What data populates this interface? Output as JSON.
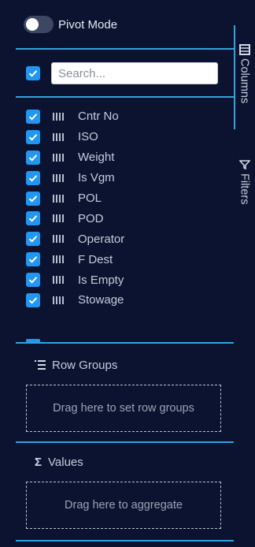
{
  "pivot": {
    "label": "Pivot Mode",
    "enabled": false
  },
  "search": {
    "placeholder": "Search...",
    "value": ""
  },
  "columns": [
    {
      "label": "Cntr No",
      "checked": true
    },
    {
      "label": "ISO",
      "checked": true
    },
    {
      "label": "Weight",
      "checked": true
    },
    {
      "label": "Is Vgm",
      "checked": true
    },
    {
      "label": "POL",
      "checked": true
    },
    {
      "label": "POD",
      "checked": true
    },
    {
      "label": "Operator",
      "checked": true
    },
    {
      "label": "F Dest",
      "checked": true
    },
    {
      "label": "Is Empty",
      "checked": true
    },
    {
      "label": "Stowage",
      "checked": true
    }
  ],
  "row_groups": {
    "title": "Row Groups",
    "drop_text": "Drag here to set row groups",
    "icon": "row-groups-icon"
  },
  "values": {
    "title": "Values",
    "drop_text": "Drag here to aggregate",
    "icon": "sigma-icon"
  },
  "sidebar": {
    "tabs": [
      {
        "label": "Columns",
        "icon": "columns-icon",
        "active": true
      },
      {
        "label": "Filters",
        "icon": "filter-icon",
        "active": false
      }
    ]
  },
  "colors": {
    "background": "#0b1331",
    "accent": "#2fa3dc",
    "checkbox": "#2196f3"
  }
}
